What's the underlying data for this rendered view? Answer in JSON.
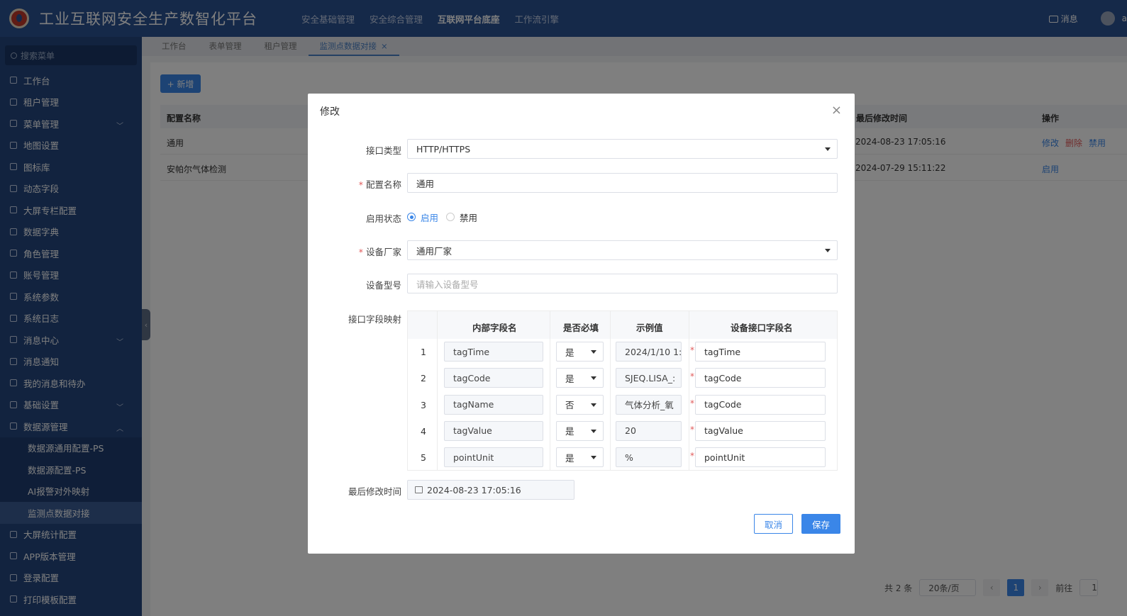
{
  "header": {
    "title": "工业互联网安全生产数智化平台",
    "nav": [
      "安全基础管理",
      "安全综合管理",
      "互联网平台底座",
      "工作流引擎"
    ],
    "nav_active_index": 2,
    "messages_label": "消息",
    "user_name": "a"
  },
  "sidebar": {
    "search_placeholder": "搜索菜单",
    "items": [
      {
        "label": "工作台",
        "icon": "home-icon"
      },
      {
        "label": "租户管理",
        "icon": "tenant-icon"
      },
      {
        "label": "菜单管理",
        "icon": "menu-icon",
        "expandable": true
      },
      {
        "label": "地图设置",
        "icon": "map-icon"
      },
      {
        "label": "图标库",
        "icon": "icon-library-icon"
      },
      {
        "label": "动态字段",
        "icon": "dynamic-field-icon"
      },
      {
        "label": "大屏专栏配置",
        "icon": "monitor-icon"
      },
      {
        "label": "数据字典",
        "icon": "dictionary-icon"
      },
      {
        "label": "角色管理",
        "icon": "role-icon"
      },
      {
        "label": "账号管理",
        "icon": "key-icon"
      },
      {
        "label": "系统参数",
        "icon": "sliders-icon"
      },
      {
        "label": "系统日志",
        "icon": "log-icon"
      },
      {
        "label": "消息中心",
        "icon": "message-icon",
        "expandable": true
      },
      {
        "label": "消息通知",
        "icon": "speaker-icon"
      },
      {
        "label": "我的消息和待办",
        "icon": "bell-icon"
      },
      {
        "label": "基础设置",
        "icon": "settings-icon",
        "expandable": true
      },
      {
        "label": "数据源管理",
        "icon": "datasource-icon",
        "expanded": true
      }
    ],
    "sub_items": [
      "数据源通用配置-PS",
      "数据源配置-PS",
      "AI报警对外映射",
      "监测点数据对接"
    ],
    "sub_active_index": 3,
    "after_items": [
      {
        "label": "大屏统计配置",
        "icon": "dashboard-icon"
      },
      {
        "label": "APP版本管理",
        "icon": "phone-icon"
      },
      {
        "label": "登录配置",
        "icon": "login-icon"
      },
      {
        "label": "打印模板配置",
        "icon": "print-icon"
      }
    ],
    "collapse_glyph": "‹"
  },
  "tabs": [
    "工作台",
    "表单管理",
    "租户管理",
    "监测点数据对接"
  ],
  "tab_active_index": 3,
  "tab_close_glyph": "×",
  "main": {
    "add_button": "+ 新增",
    "columns": {
      "name": "配置名称",
      "modified": "最后修改时间",
      "ops": "操作"
    },
    "rows": [
      {
        "name": "通用",
        "modified": "2024-08-23 17:05:16",
        "ops": [
          "修改",
          "删除",
          "禁用"
        ]
      },
      {
        "name": "安帕尔气体检测",
        "modified": "2024-07-29 15:11:22",
        "ops": [
          "启用"
        ]
      }
    ],
    "pager": {
      "total": "共 2 条",
      "page_size": "20条/页",
      "prev": "‹",
      "next": "›",
      "current": "1",
      "goto_label": "前往",
      "goto_value": "1"
    }
  },
  "modal": {
    "title": "修改",
    "close_glyph": "×",
    "fields": {
      "interface_type": {
        "label": "接口类型",
        "value": "HTTP/HTTPS"
      },
      "config_name": {
        "label": "配置名称",
        "value": "通用",
        "required": true
      },
      "status": {
        "label": "启用状态",
        "options": [
          "启用",
          "禁用"
        ],
        "selected": "启用"
      },
      "vendor": {
        "label": "设备厂家",
        "value": "通用厂家",
        "required": true
      },
      "model": {
        "label": "设备型号",
        "placeholder": "请输入设备型号"
      },
      "mapping_label": "接口字段映射",
      "modified_label": "最后修改时间",
      "modified_value": "2024-08-23 17:05:16"
    },
    "mapping": {
      "headers": [
        "内部字段名",
        "是否必填",
        "示例值",
        "设备接口字段名"
      ],
      "rows": [
        {
          "index": "1",
          "internal": "tagTime",
          "required": "是",
          "example": "2024/1/10 1:",
          "device": "tagTime"
        },
        {
          "index": "2",
          "internal": "tagCode",
          "required": "是",
          "example": "SJEQ.LISA_:",
          "device": "tagCode"
        },
        {
          "index": "3",
          "internal": "tagName",
          "required": "否",
          "example": "气体分析_氧",
          "device": "tagCode"
        },
        {
          "index": "4",
          "internal": "tagValue",
          "required": "是",
          "example": "20",
          "device": "tagValue"
        },
        {
          "index": "5",
          "internal": "pointUnit",
          "required": "是",
          "example": "%",
          "device": "pointUnit"
        }
      ],
      "required_mark": "*"
    },
    "cancel_label": "取消",
    "save_label": "保存"
  }
}
